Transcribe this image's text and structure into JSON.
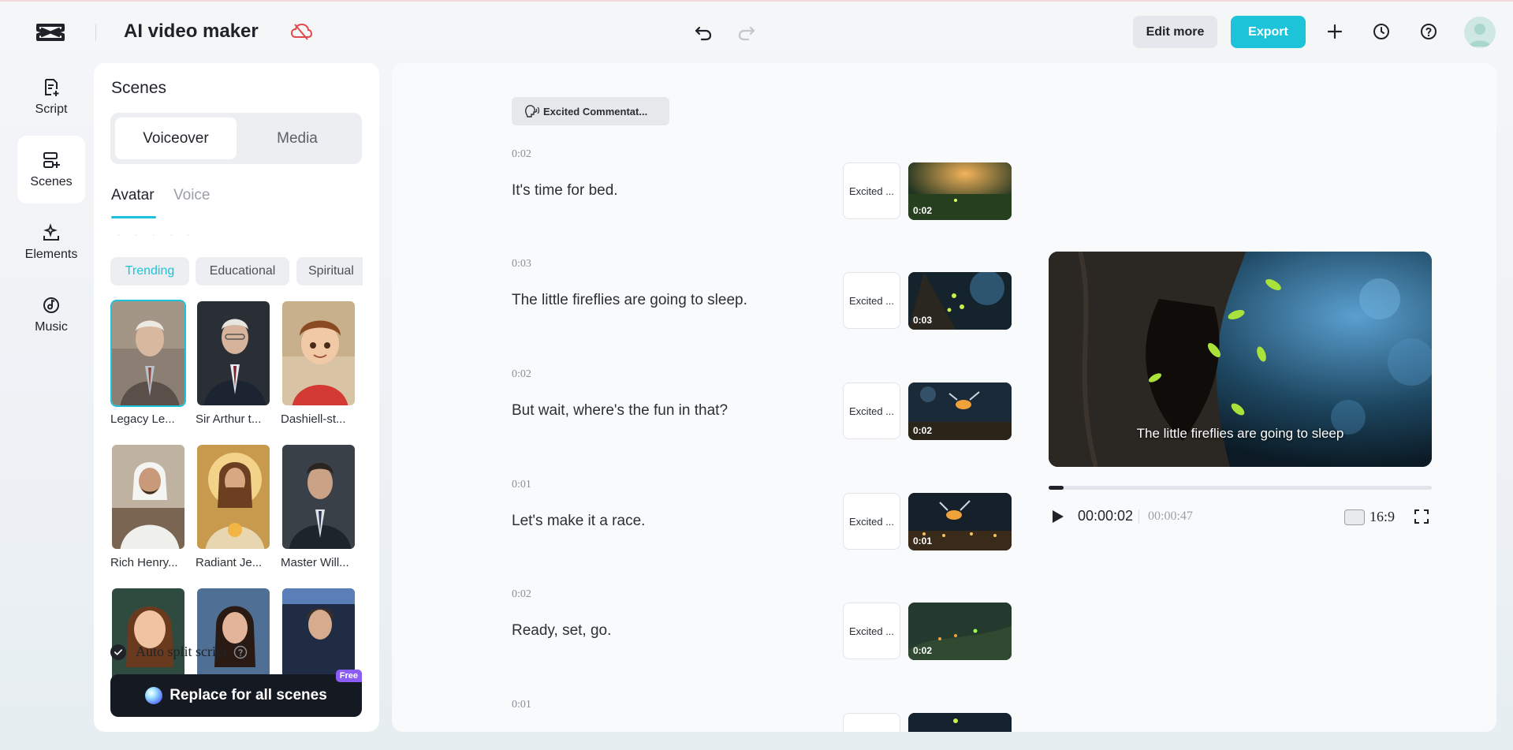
{
  "header": {
    "title": "AI video maker",
    "edit_more": "Edit more",
    "export": "Export"
  },
  "rail": {
    "items": [
      {
        "label": "Script",
        "icon": "script-icon"
      },
      {
        "label": "Scenes",
        "icon": "scenes-icon",
        "active": true
      },
      {
        "label": "Elements",
        "icon": "elements-icon"
      },
      {
        "label": "Music",
        "icon": "music-icon"
      }
    ]
  },
  "scenes_panel": {
    "title": "Scenes",
    "segments": [
      "Voiceover",
      "Media"
    ],
    "subtabs": [
      "Avatar",
      "Voice"
    ],
    "chips": [
      "Trending",
      "Educational",
      "Spiritual"
    ],
    "avatars": [
      {
        "name": "Legacy Le..."
      },
      {
        "name": "Sir Arthur t..."
      },
      {
        "name": "Dashiell-st..."
      },
      {
        "name": "Rich Henry..."
      },
      {
        "name": "Radiant Je..."
      },
      {
        "name": "Master Will..."
      }
    ],
    "auto_split": "Auto split script",
    "replace_button": "Replace for all scenes",
    "free_badge": "Free"
  },
  "main": {
    "voice_chip": "Excited Commentat...",
    "scenes": [
      {
        "duration": "0:02",
        "text": "It's time for bed.",
        "voice": "Excited ...",
        "clip_time": "0:02"
      },
      {
        "duration": "0:03",
        "text": "The little fireflies are going to sleep.",
        "voice": "Excited ...",
        "clip_time": "0:03"
      },
      {
        "duration": "0:02",
        "text": "But wait, where's the fun in that?",
        "voice": "Excited ...",
        "clip_time": "0:02"
      },
      {
        "duration": "0:01",
        "text": "Let's make it a race.",
        "voice": "Excited ...",
        "clip_time": "0:01"
      },
      {
        "duration": "0:02",
        "text": "Ready, set, go.",
        "voice": "Excited ...",
        "clip_time": "0:02"
      },
      {
        "duration": "0:01",
        "text": "",
        "voice": "",
        "clip_time": ""
      }
    ]
  },
  "preview": {
    "caption": "The little fireflies are going to sleep",
    "current_time": "00:00:02",
    "total_time": "00:00:47",
    "aspect_ratio": "16:9",
    "progress": 0.04
  },
  "colors": {
    "accent": "#1dc3d8",
    "dark": "#151922",
    "badge": "#8b5cf6"
  }
}
